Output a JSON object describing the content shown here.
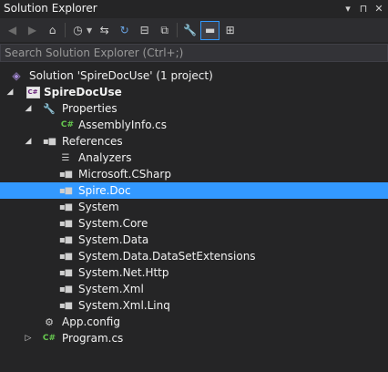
{
  "panel": {
    "title": "Solution Explorer",
    "actions": {
      "dropdown": "▾",
      "pin": "⊓",
      "close": "✕"
    }
  },
  "toolbar": {
    "buttons": [
      {
        "icon": "back-icon",
        "glyph": "◀"
      },
      {
        "icon": "forward-icon",
        "glyph": "▶"
      },
      {
        "icon": "home-icon",
        "glyph": "⌂"
      },
      {
        "icon": "pending-changes-icon",
        "glyph": "◷"
      },
      {
        "icon": "sync-icon",
        "glyph": "⇆"
      },
      {
        "icon": "refresh-icon",
        "glyph": "↻"
      },
      {
        "icon": "collapse-all-icon",
        "glyph": "⊟"
      },
      {
        "icon": "show-all-files-icon",
        "glyph": "⧉"
      },
      {
        "icon": "properties-icon",
        "glyph": "🔧"
      },
      {
        "icon": "preview-icon",
        "glyph": "▬"
      },
      {
        "icon": "class-view-icon",
        "glyph": "⊞"
      }
    ]
  },
  "search": {
    "placeholder": "Search Solution Explorer (Ctrl+;)",
    "value": ""
  },
  "tree": {
    "solution": "Solution 'SpireDocUse' (1 project)",
    "project": "SpireDocUse",
    "properties": "Properties",
    "assemblyinfo": "AssemblyInfo.cs",
    "references": "References",
    "refs": [
      "Analyzers",
      "Microsoft.CSharp",
      "Spire.Doc",
      "System",
      "System.Core",
      "System.Data",
      "System.Data.DataSetExtensions",
      "System.Net.Http",
      "System.Xml",
      "System.Xml.Linq"
    ],
    "appconfig": "App.config",
    "program": "Program.cs",
    "selected": "Spire.Doc"
  },
  "colors": {
    "selection": "#3399ff",
    "background": "#252526",
    "csharp": "#66c84f"
  }
}
